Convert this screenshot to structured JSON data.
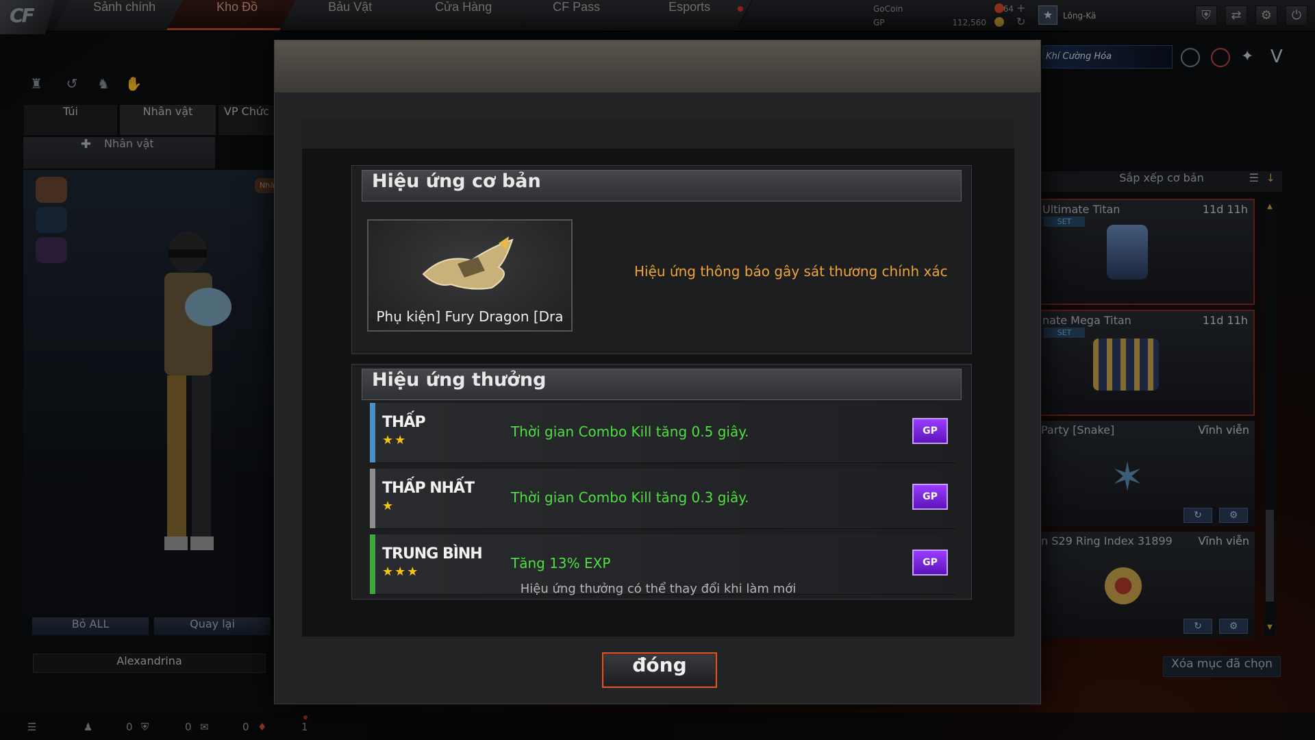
{
  "topbar": {
    "tabs": [
      "Sảnh chính",
      "Kho Đồ",
      "Bảu Vật",
      "Cửa Hàng",
      "CF Pass",
      "Esports"
    ],
    "active_tab": "Kho Đồ",
    "currencies": [
      {
        "label": "GoCoin",
        "value": "64"
      },
      {
        "label": "GP",
        "value": "112,560"
      }
    ],
    "user": {
      "name": "Lõng-Kä"
    },
    "promo_text": "Khí Cường Hóa"
  },
  "left_panel": {
    "tabs": [
      "Túi",
      "Nhân vật",
      "VP Chức"
    ],
    "active_tab": "Nhân vật",
    "character_tab": "Nhân vật",
    "small_tag": "Nhâ",
    "buttons": [
      "Bỏ ALL",
      "Quay lại"
    ],
    "character_name": "Alexandrina"
  },
  "right_panel": {
    "sort_label": "Sắp xếp cơ bản",
    "items": [
      {
        "name": "Ultimate Titan",
        "time": "11d 11h",
        "set": "SET"
      },
      {
        "name": "nate Mega Titan",
        "time": "11d 11h",
        "set": "SET"
      },
      {
        "name": "Party [Snake]",
        "time": "Vĩnh viễn",
        "set": ""
      },
      {
        "name": "n S29 Ring Index 31899",
        "time": "Vĩnh viễn",
        "set": ""
      }
    ],
    "clear_button": "Xóa mục đã chọn"
  },
  "statusbar": {
    "counts": [
      "0",
      "0",
      "0",
      "1"
    ]
  },
  "modal": {
    "basic_section": {
      "title": "Hiệu ứng cơ bản",
      "item_label": "Phụ kiện] Fury Dragon [Dra",
      "description": "Hiệu ứng thông báo gây sát thương chính xác"
    },
    "bonus_section": {
      "title": "Hiệu ứng thưởng",
      "effects": [
        {
          "grade": "THẤP",
          "stars": "★★",
          "text": "Thời gian Combo Kill tăng 0.5 giây.",
          "color": "#4a8fc8",
          "button": "GP"
        },
        {
          "grade": "THẤP NHẤT",
          "stars": "★",
          "text": "Thời gian Combo Kill tăng 0.3 giây.",
          "color": "#8d8d8d",
          "button": "GP"
        },
        {
          "grade": "TRUNG BÌNH",
          "stars": "★★★",
          "text": "Tăng 13% EXP",
          "color": "#3fa63c",
          "button": "GP"
        }
      ]
    },
    "note": "Hiệu ứng thưởng có thể thay đổi khi làm mới",
    "close_label": "đóng"
  }
}
